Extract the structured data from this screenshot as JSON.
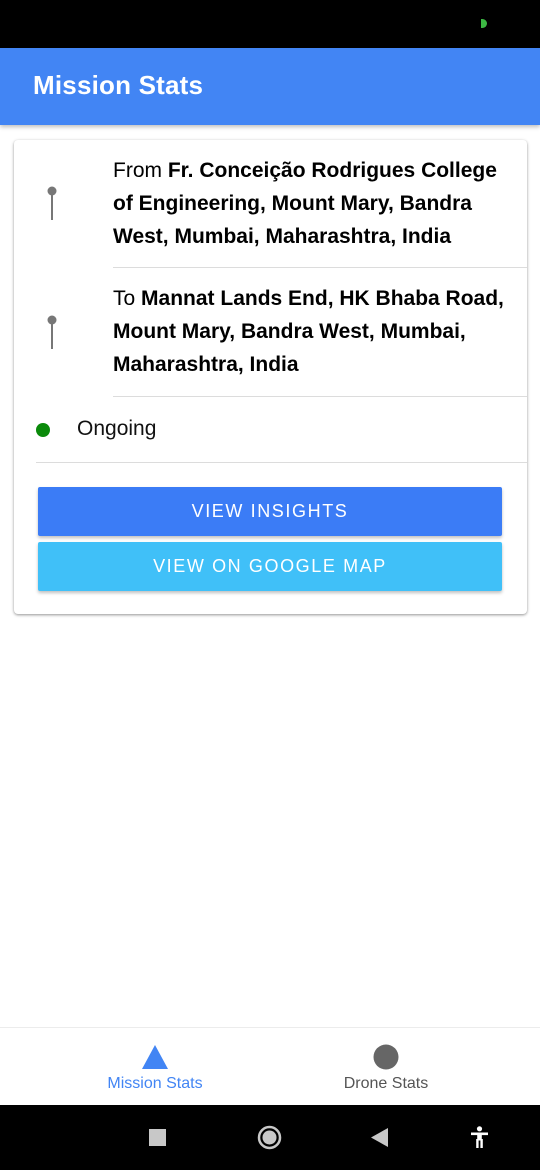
{
  "app": {
    "title": "Mission Stats",
    "accent_color": "#4285f4"
  },
  "mission": {
    "from": {
      "prefix": "From",
      "place": "Fr. Conceição Rodrigues College of Engineering, Mount Mary, Bandra West, Mumbai, Maharashtra, India",
      "icon": "pin-icon"
    },
    "to": {
      "prefix": "To",
      "place": "Mannat Lands End, HK Bhaba Road, Mount Mary, Bandra West, Mumbai, Maharashtra, India",
      "icon": "pin-icon"
    },
    "status": {
      "label": "Ongoing",
      "color": "#0a8a0a"
    },
    "buttons": {
      "insights": "VIEW INSIGHTS",
      "map": "VIEW ON GOOGLE MAP"
    }
  },
  "bottom_nav": {
    "items": [
      {
        "label": "Mission Stats",
        "icon": "triangle-icon",
        "active": true
      },
      {
        "label": "Drone Stats",
        "icon": "circle-icon",
        "active": false
      }
    ]
  },
  "system_nav": {
    "icons": [
      "recents-icon",
      "home-icon",
      "back-icon",
      "accessibility-icon"
    ]
  }
}
